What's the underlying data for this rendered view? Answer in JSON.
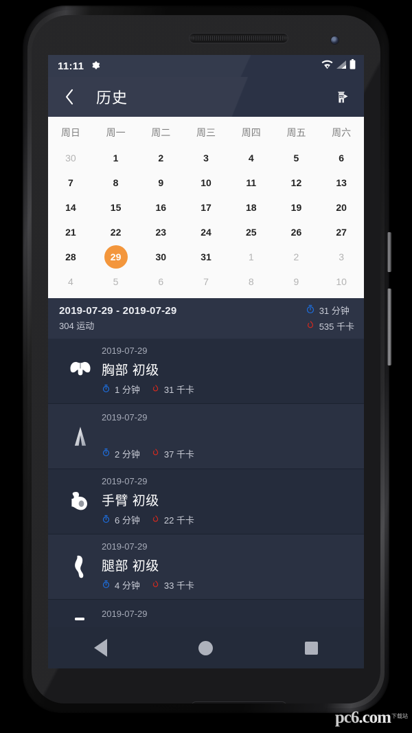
{
  "device": {
    "name": "android-phone-mockup"
  },
  "status_bar": {
    "time": "11:11",
    "gear_icon": "gear-icon",
    "wifi_icon": "wifi-off-icon",
    "signal_icon": "cellular-signal-icon",
    "battery_icon": "battery-full-icon"
  },
  "app_bar": {
    "back_icon": "chevron-left-icon",
    "title": "历史",
    "action_icon": "ad-billboard-icon",
    "action_label": "AD"
  },
  "calendar": {
    "weekdays": [
      "周日",
      "周一",
      "周二",
      "周三",
      "周四",
      "周五",
      "周六"
    ],
    "selected_day": "29",
    "accent_color": "#f3963c",
    "weeks": [
      [
        {
          "d": "30",
          "o": true
        },
        {
          "d": "1"
        },
        {
          "d": "2"
        },
        {
          "d": "3"
        },
        {
          "d": "4"
        },
        {
          "d": "5"
        },
        {
          "d": "6"
        }
      ],
      [
        {
          "d": "7"
        },
        {
          "d": "8"
        },
        {
          "d": "9"
        },
        {
          "d": "10"
        },
        {
          "d": "11"
        },
        {
          "d": "12"
        },
        {
          "d": "13"
        }
      ],
      [
        {
          "d": "14"
        },
        {
          "d": "15"
        },
        {
          "d": "16"
        },
        {
          "d": "17"
        },
        {
          "d": "18"
        },
        {
          "d": "19"
        },
        {
          "d": "20"
        }
      ],
      [
        {
          "d": "21"
        },
        {
          "d": "22"
        },
        {
          "d": "23"
        },
        {
          "d": "24"
        },
        {
          "d": "25"
        },
        {
          "d": "26"
        },
        {
          "d": "27"
        }
      ],
      [
        {
          "d": "28"
        },
        {
          "d": "29",
          "sel": true
        },
        {
          "d": "30"
        },
        {
          "d": "31"
        },
        {
          "d": "1",
          "o": true
        },
        {
          "d": "2",
          "o": true
        },
        {
          "d": "3",
          "o": true
        }
      ],
      [
        {
          "d": "4",
          "o": true
        },
        {
          "d": "5",
          "o": true
        },
        {
          "d": "6",
          "o": true
        },
        {
          "d": "7",
          "o": true
        },
        {
          "d": "8",
          "o": true
        },
        {
          "d": "9",
          "o": true
        },
        {
          "d": "10",
          "o": true
        }
      ]
    ]
  },
  "summary": {
    "date_range": "2019-07-29 - 2019-07-29",
    "workout_count": "304 运动",
    "duration": "31 分钟",
    "calories": "535 千卡",
    "duration_icon": "stopwatch-icon",
    "calories_icon": "flame-icon",
    "duration_color": "#1d6fe0",
    "calories_color": "#d42a1e"
  },
  "history": [
    {
      "date": "2019-07-29",
      "title": "胸部 初级",
      "duration": "1 分钟",
      "calories": "31 千卡",
      "icon": "chest-icon"
    },
    {
      "date": "2019-07-29",
      "title": "",
      "duration": "2 分钟",
      "calories": "37 千卡",
      "icon": "pants-icon"
    },
    {
      "date": "2019-07-29",
      "title": "手臂 初级",
      "duration": "6 分钟",
      "calories": "22 千卡",
      "icon": "bicep-icon"
    },
    {
      "date": "2019-07-29",
      "title": "腿部 初级",
      "duration": "4 分钟",
      "calories": "33 千卡",
      "icon": "leg-icon"
    },
    {
      "date": "2019-07-29",
      "title": "",
      "duration": "",
      "calories": "",
      "icon": "partial-icon"
    }
  ],
  "nav_bar": {
    "back_icon": "nav-back-triangle-icon",
    "home_icon": "nav-home-circle-icon",
    "recents_icon": "nav-recents-square-icon"
  },
  "watermark": {
    "text": "pc6",
    "suffix": ".com",
    "cn": "下载站"
  }
}
